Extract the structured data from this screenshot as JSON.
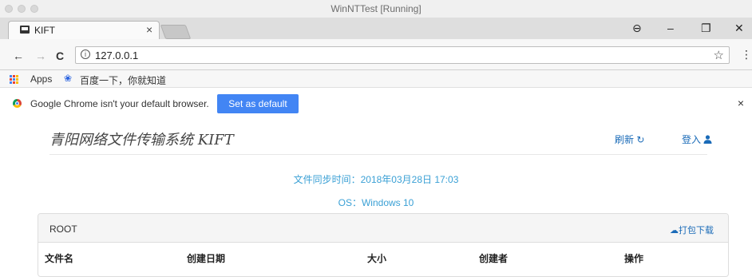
{
  "vm": {
    "title": "WinNTTest [Running]"
  },
  "browser": {
    "tab": {
      "title": "KIFT",
      "close": "×"
    },
    "window": {
      "minimize": "–",
      "restore": "❐",
      "close": "✕",
      "profile": "⊖"
    },
    "nav": {
      "back": "←",
      "forward": "→",
      "reload": "C"
    },
    "url": "127.0.0.1",
    "bookmarks": [
      {
        "label": "Apps"
      },
      {
        "label": "百度一下，你就知道"
      }
    ],
    "infobar": {
      "message": "Google Chrome isn't your default browser.",
      "button": "Set as default",
      "close": "×"
    }
  },
  "page": {
    "brand": "青阳网络文件传输系统 KIFT",
    "refresh": "刷新",
    "login": "登入",
    "sync_time": "文件同步时间：2018年03月28日 17:03",
    "os": "OS：Windows 10",
    "panel": {
      "title": "ROOT",
      "download": "打包下载",
      "columns": [
        "文件名",
        "创建日期",
        "大小",
        "创建者",
        "操作"
      ]
    }
  },
  "colors": {
    "accent": "#4285f4",
    "link": "#1a6bb8",
    "info_text": "#3aa0d5"
  }
}
